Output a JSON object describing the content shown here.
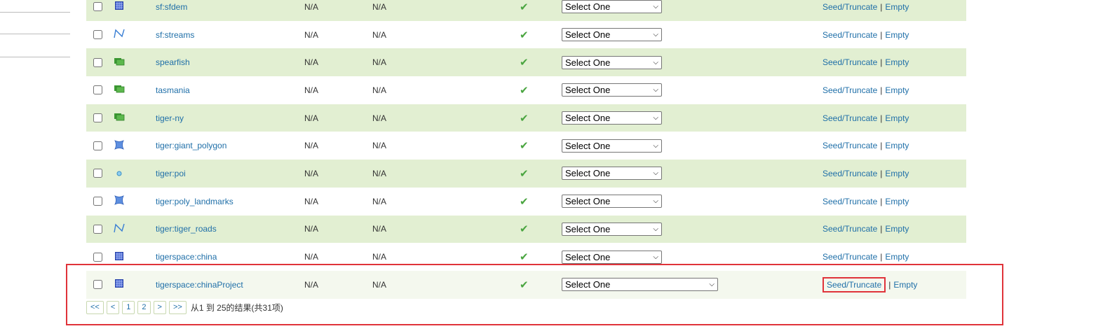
{
  "layers": [
    {
      "name": "sf:sfdem",
      "icon": "raster-icon",
      "tile_size": "N/A",
      "disk": "N/A",
      "select": "Select One",
      "seed": "Seed/Truncate",
      "empty": "Empty"
    },
    {
      "name": "sf:streams",
      "icon": "line-icon",
      "tile_size": "N/A",
      "disk": "N/A",
      "select": "Select One",
      "seed": "Seed/Truncate",
      "empty": "Empty"
    },
    {
      "name": "spearfish",
      "icon": "layergroup-icon",
      "tile_size": "N/A",
      "disk": "N/A",
      "select": "Select One",
      "seed": "Seed/Truncate",
      "empty": "Empty"
    },
    {
      "name": "tasmania",
      "icon": "layergroup-icon",
      "tile_size": "N/A",
      "disk": "N/A",
      "select": "Select One",
      "seed": "Seed/Truncate",
      "empty": "Empty"
    },
    {
      "name": "tiger-ny",
      "icon": "layergroup-icon",
      "tile_size": "N/A",
      "disk": "N/A",
      "select": "Select One",
      "seed": "Seed/Truncate",
      "empty": "Empty"
    },
    {
      "name": "tiger:giant_polygon",
      "icon": "polygon-icon",
      "tile_size": "N/A",
      "disk": "N/A",
      "select": "Select One",
      "seed": "Seed/Truncate",
      "empty": "Empty"
    },
    {
      "name": "tiger:poi",
      "icon": "point-icon",
      "tile_size": "N/A",
      "disk": "N/A",
      "select": "Select One",
      "seed": "Seed/Truncate",
      "empty": "Empty"
    },
    {
      "name": "tiger:poly_landmarks",
      "icon": "polygon-icon",
      "tile_size": "N/A",
      "disk": "N/A",
      "select": "Select One",
      "seed": "Seed/Truncate",
      "empty": "Empty"
    },
    {
      "name": "tiger:tiger_roads",
      "icon": "line-icon",
      "tile_size": "N/A",
      "disk": "N/A",
      "select": "Select One",
      "seed": "Seed/Truncate",
      "empty": "Empty"
    },
    {
      "name": "tigerspace:china",
      "icon": "raster-icon",
      "tile_size": "N/A",
      "disk": "N/A",
      "select": "Select One",
      "seed": "Seed/Truncate",
      "empty": "Empty"
    },
    {
      "name": "tigerspace:chinaProject",
      "icon": "raster-icon",
      "tile_size": "N/A",
      "disk": "N/A",
      "select": "Select One",
      "seed": "Seed/Truncate",
      "empty": "Empty"
    }
  ],
  "separator": "|",
  "pager": {
    "first": "<<",
    "prev": "<",
    "pages": [
      "1",
      "2"
    ],
    "next": ">",
    "last": ">>",
    "info": "从1 到 25的结果(共31项)"
  },
  "colors": {
    "link": "#1f6fa8",
    "row_alt": "#e2efd2",
    "highlight": "#e0333a",
    "check": "#4aa540"
  }
}
